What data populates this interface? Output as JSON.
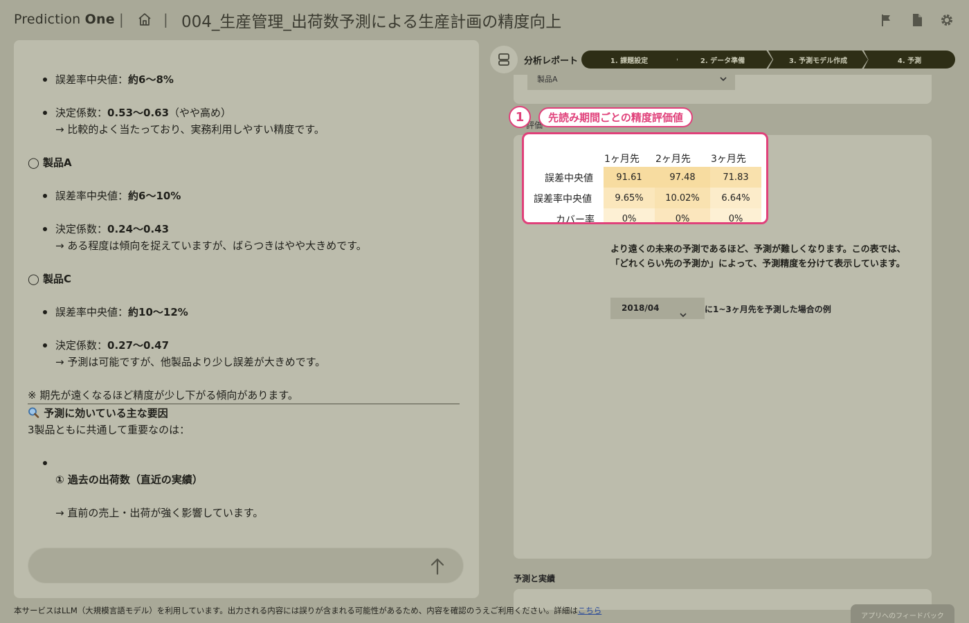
{
  "header": {
    "brand_light": "Prediction ",
    "brand_bold": "One",
    "sep": "|",
    "project_title": "004_生産管理_出荷数予測による生産計画の精度向上"
  },
  "icons": {
    "home": "home-icon",
    "flag": "flag-icon",
    "document": "document-icon",
    "settings": "gear-icon",
    "robot": "robot-icon",
    "send": "arrow-up-icon",
    "search": "magnifier-icon"
  },
  "chat": {
    "l1_label": "誤差率中央値：",
    "l1_value": "約6～8%",
    "l2_label": "決定係数：",
    "l2_value": "0.53～0.63",
    "l2_suffix": "（やや高め）",
    "l3": "→ 比較的よく当たっており、実務利用しやすい精度です。",
    "h_a": "◯ 製品A",
    "a1_label": "誤差率中央値：",
    "a1_value": "約6～10%",
    "a2_label": "決定係数：",
    "a2_value": "0.24～0.43",
    "a3": "→ ある程度は傾向を捉えていますが、ばらつきはやや大きめです。",
    "h_c": "◯ 製品C",
    "c1_label": "誤差率中央値：",
    "c1_value": "約10～12%",
    "c2_label": "決定係数：",
    "c2_value": "0.27～0.47",
    "c3": "→ 予測は可能ですが、他製品より少し誤差が大きめです。",
    "note": "※ 期先が遠くなるほど精度が少し下がる傾向があります。",
    "factors_heading": "予測に効いている主な要因",
    "factors_intro": "3製品ともに共通して重要なのは：",
    "factor1": "① 過去の出荷数（直近の実績）",
    "factor1_desc": "→ 直前の売上・出荷が強く影響しています。",
    "input_placeholder": ""
  },
  "report": {
    "title": "分析レポート",
    "steps": [
      "1. 課題設定",
      "2. データ準備",
      "3. 予測モデル作成",
      "4. 予測"
    ],
    "product_select": "製品A",
    "section_eval": "評価",
    "annotation_number": "1",
    "annotation_label": "先読み期間ごとの精度評価値",
    "table": {
      "columns": [
        "1ヶ月先",
        "2ヶ月先",
        "3ヶ月先"
      ],
      "rows": [
        {
          "label": "誤差中央値",
          "values": [
            "91.61",
            "97.48",
            "71.83"
          ]
        },
        {
          "label": "誤差率中央値",
          "values": [
            "9.65%",
            "10.02%",
            "6.64%"
          ]
        },
        {
          "label": "カバー率",
          "values": [
            "0%",
            "0%",
            "0%"
          ]
        }
      ],
      "cell_color_strong": "#f7dca0",
      "cell_color_mid": "#fbe7bc",
      "cell_color_light": "#fdf0d4"
    },
    "description": "より遠くの未来の予測であるほど、予測が難しくなります。この表では、「どれくらい先の予測か」によって、予測精度を分けて表示しています。",
    "date_select": "2018/04",
    "date_note": "に1~3ヶ月先を予測した場合の例",
    "section_forecast": "予測と実績"
  },
  "footer": {
    "text": "本サービスはLLM（大規模言語モデル）を利用しています。出力される内容には誤りが含まれる可能性があるため、内容を確認のうえご利用ください。詳細は",
    "link": "こちら",
    "feedback": "アプリへのフィードバック"
  },
  "colors": {
    "background": "#a9a998",
    "panel": "#bcbcac",
    "step_bg": "#2e2e16",
    "accent": "#e0407a"
  }
}
